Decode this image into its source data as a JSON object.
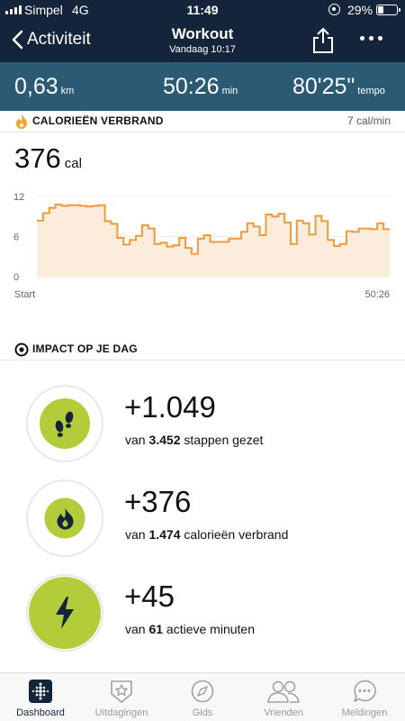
{
  "status_bar": {
    "carrier": "Simpel",
    "network": "4G",
    "time": "11:49",
    "battery": "29%",
    "battery_level": 0.29
  },
  "header": {
    "back_label": "Activiteit",
    "title": "Workout",
    "subtitle": "Vandaag 10:17"
  },
  "stats": [
    {
      "value": "0,63",
      "unit": "km"
    },
    {
      "value": "50:26",
      "unit": "min"
    },
    {
      "value": "80'25\"",
      "unit": "tempo"
    }
  ],
  "calories": {
    "title": "CALORIEËN VERBRAND",
    "rate": "7 cal/min",
    "value": "376",
    "unit": "cal",
    "x_start": "Start",
    "x_end": "50:26"
  },
  "chart_data": {
    "type": "area",
    "title": "",
    "xlabel": "",
    "ylabel": "",
    "ylim": [
      0,
      12
    ],
    "y_ticks": [
      "12",
      "6",
      "0"
    ],
    "x_labels": [
      "Start",
      "50:26"
    ],
    "x": [
      0,
      1,
      2,
      3,
      4,
      5,
      6,
      7,
      8,
      9,
      10,
      11,
      12,
      13,
      14,
      15,
      16,
      17,
      18,
      19,
      20,
      21,
      22,
      23,
      24,
      25,
      26,
      27,
      28,
      29,
      30,
      31,
      32,
      33,
      34,
      35,
      36,
      37,
      38,
      39,
      40,
      41,
      42,
      43,
      44,
      45,
      46,
      47,
      48,
      49,
      50
    ],
    "values": [
      8.4,
      9.5,
      10.3,
      10.8,
      10.6,
      10.7,
      10.7,
      10.6,
      10.5,
      10.6,
      10.7,
      8.3,
      7.9,
      5.8,
      4.8,
      5.5,
      6.1,
      7.7,
      7.2,
      4.9,
      5.1,
      4.5,
      4.7,
      5.8,
      4.3,
      3.4,
      5.7,
      6.2,
      5.2,
      5.2,
      5.2,
      5.7,
      5.7,
      6.7,
      8.0,
      7.5,
      6.2,
      9.3,
      9.0,
      9.4,
      8.1,
      4.9,
      8.4,
      8.0,
      6.3,
      9.1,
      8.3,
      5.5,
      4.6,
      4.9,
      6.8,
      6.7,
      7.2,
      7.2,
      7.1,
      8.0,
      7.1
    ],
    "colors": {
      "line": "#ef9a3c",
      "fill": "#fbecdc"
    },
    "grid": true
  },
  "impact": {
    "title": "IMPACT OP JE DAG",
    "items": [
      {
        "icon": "footsteps-icon",
        "big": "+1.049",
        "prefix": "van ",
        "bold": "3.452",
        "suffix": " stappen gezet"
      },
      {
        "icon": "flame-icon",
        "big": "+376",
        "prefix": "van ",
        "bold": "1.474",
        "suffix": " calorieën verbrand"
      },
      {
        "icon": "lightning-icon",
        "big": "+45",
        "prefix": "van ",
        "bold": "61",
        "suffix": " actieve minuten"
      }
    ]
  },
  "tabs": [
    {
      "label": "Dashboard",
      "icon": "dashboard-icon",
      "active": true
    },
    {
      "label": "Uitdagingen",
      "icon": "challenges-star-icon",
      "active": false
    },
    {
      "label": "Gids",
      "icon": "compass-icon",
      "active": false
    },
    {
      "label": "Vrienden",
      "icon": "friends-icon",
      "active": false
    },
    {
      "label": "Meldingen",
      "icon": "chat-bubble-icon",
      "active": false
    }
  ],
  "colors": {
    "header": "#14243a",
    "stats_bar": "#2a5a74",
    "accent_green": "#b3cc3a",
    "chart_orange": "#ef9a3c"
  }
}
